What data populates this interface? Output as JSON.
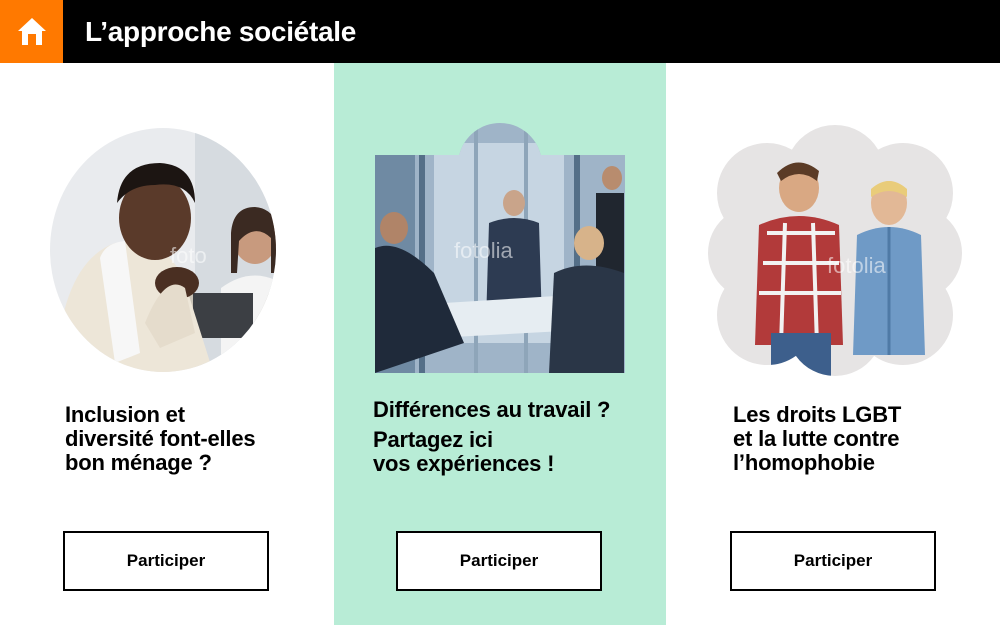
{
  "header": {
    "title": "L’approche sociétale",
    "home_icon": "home-icon",
    "home_color": "#ff7900"
  },
  "cards": [
    {
      "line1": "Inclusion et",
      "line2": "diversité font-elles",
      "line3": "bon ménage ?",
      "watermark": "foto",
      "button": "Participer"
    },
    {
      "line1": "Différences au travail ?",
      "line2": "Partagez ici",
      "line3": "vos expériences !",
      "watermark": "fotolia",
      "button": "Participer",
      "background": "#b8ecd6"
    },
    {
      "line1": "Les droits LGBT",
      "line2": "et la lutte contre",
      "line3": "l’homophobie",
      "watermark": "fotolia",
      "button": "Participer"
    }
  ]
}
